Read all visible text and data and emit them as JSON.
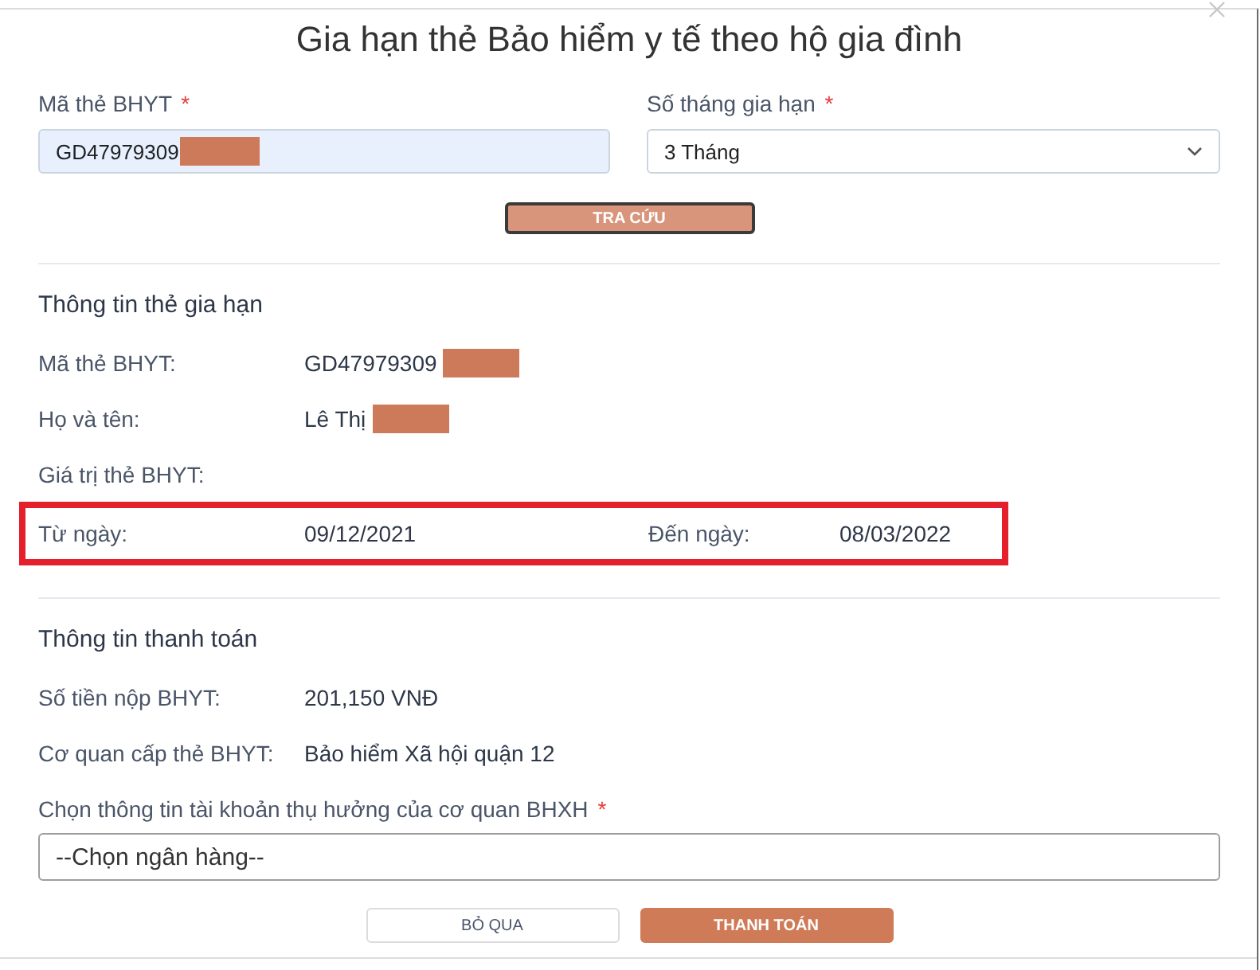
{
  "dialog": {
    "title": "Gia hạn thẻ Bảo hiểm y tế theo hộ gia đình"
  },
  "lookup_form": {
    "card_number": {
      "label": "Mã thẻ BHYT",
      "required_mark": "*",
      "value": "GD47979309",
      "redacted": true,
      "autofilled": true
    },
    "months": {
      "label": "Số tháng gia hạn",
      "required_mark": "*",
      "value": "3 Tháng"
    },
    "search_button": "TRA CỨU"
  },
  "card_info": {
    "heading": "Thông tin thẻ gia hạn",
    "rows": [
      {
        "label": "Mã thẻ BHYT:",
        "value": "GD47979309",
        "redacted": true
      },
      {
        "label": "Họ và tên:",
        "value": "Lê Thị",
        "redacted": true
      },
      {
        "label": "Giá trị thẻ BHYT:"
      }
    ],
    "validity": {
      "highlighted": true,
      "from_label": "Từ ngày:",
      "from_value": "09/12/2021",
      "to_label": "Đến ngày:",
      "to_value": "08/03/2022"
    }
  },
  "payment_info": {
    "heading": "Thông tin thanh toán",
    "rows": [
      {
        "label": "Số tiền nộp BHYT:",
        "value": "201,150 VNĐ"
      },
      {
        "label": "Cơ quan cấp thẻ BHYT:",
        "value": "Bảo hiểm Xã hội quận 12"
      }
    ],
    "bank_account": {
      "label": "Chọn thông tin tài khoản thụ hưởng của cơ quan BHXH",
      "required_mark": "*",
      "placeholder": "--Chọn ngân hàng--"
    }
  },
  "buttons": [
    {
      "label": "BỎ QUA",
      "kind": "secondary"
    },
    {
      "label": "THANH TOÁN",
      "kind": "primary"
    }
  ]
}
